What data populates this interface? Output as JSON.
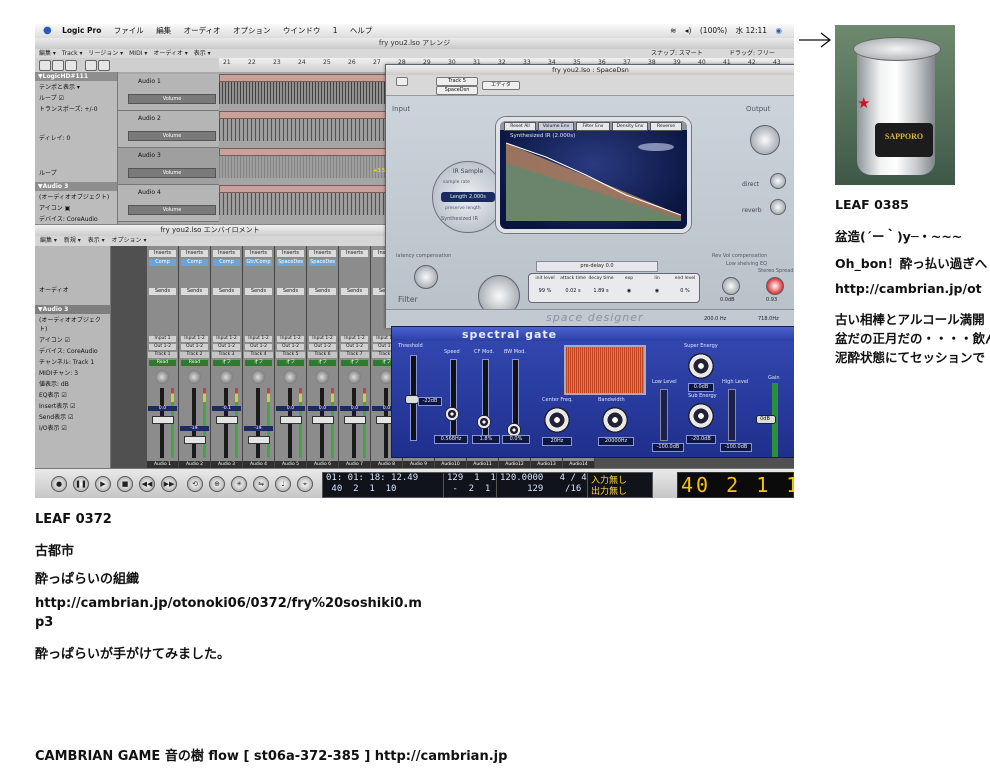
{
  "menubar": {
    "app": "Logic Pro",
    "items": [
      "ファイル",
      "編集",
      "オーディオ",
      "オプション",
      "ウインドウ",
      "1",
      "ヘルプ"
    ],
    "status": [
      "(100%)",
      "水 12:11"
    ]
  },
  "arrange": {
    "title": "fry you2.lso アレンジ",
    "toolbar": [
      "編集 ▾",
      "Track ▾",
      "リージョン ▾",
      "MIDI ▾",
      "オーディオ ▾",
      "表示 ▾"
    ],
    "toolbar_right": [
      "スナップ: スマート",
      "ドラッグ: フリー"
    ],
    "ruler": [
      "21",
      "22",
      "23",
      "24",
      "25",
      "26",
      "27",
      "28",
      "29",
      "30",
      "31",
      "32",
      "33",
      "34",
      "35",
      "36",
      "37",
      "38",
      "39",
      "40",
      "41",
      "42",
      "43"
    ],
    "inspector": {
      "header": "▼LogicHD#111",
      "rows": [
        "テンポと表示 ▾",
        "ループ ☑",
        "トランスポーズ: +/-0",
        "ディレイ: 0",
        "ループ",
        "▼Audio 3",
        "(オーディオオブジェクト)",
        "アイコン ▣",
        "デバイス: CoreAudio"
      ]
    },
    "tracks": [
      {
        "num": "1",
        "name": "Audio 1",
        "region": "LogicHD#109",
        "vol": "Volume"
      },
      {
        "num": "2",
        "name": "Audio 2",
        "region": "LogicHD#110",
        "vol": "Volume"
      },
      {
        "num": "3",
        "name": "Audio 3",
        "region": "LogicHD#111",
        "vol": "Volume"
      },
      {
        "num": "4",
        "name": "Audio 4",
        "region": "LogicHD#112",
        "vol": "Volume"
      }
    ],
    "region_gain": "+3.5 dB"
  },
  "environment": {
    "title": "fry you2.lso エンバイロメント",
    "tools": [
      "編集 ▾",
      "新規 ▾",
      "表示 ▾",
      "オプション ▾"
    ],
    "layer": "オーディオ",
    "left_header": "▼Audio 3",
    "left_rows": [
      "(オーディオオブジェクト)",
      "アイコン ☑",
      "デバイス: CoreAudio",
      "チャンネル: Track 1",
      "MIDIチャン: 3",
      "値表示: dB",
      "EQ表示 ☑",
      "Insert表示 ☑",
      "Send表示 ☑",
      "I/O表示 ☑"
    ],
    "strips": [
      {
        "ins": "Inserts",
        "plugin": "Comp",
        "io1": "Input 1",
        "io2": "Out 1-2",
        "track": "Track 1",
        "mode": "Read",
        "level": "0.0",
        "bottom": "Audio 1"
      },
      {
        "ins": "Inserts",
        "plugin": "Comp",
        "io1": "Input 1-2",
        "io2": "Out 1-2",
        "track": "Track 2",
        "mode": "Read",
        "level": "-19.",
        "bottom": "Audio 2"
      },
      {
        "ins": "Inserts",
        "plugin": "Comp",
        "io1": "Input 1-2",
        "io2": "Out 1-2",
        "track": "Track 3",
        "mode": "オフ",
        "level": "-0.1",
        "bottom": "Audio 3"
      },
      {
        "ins": "Inserts",
        "plugin": "Gtr/Comp",
        "io1": "Input 1-2",
        "io2": "Out 1-2",
        "track": "Track 4",
        "mode": "オフ",
        "level": "-19.",
        "bottom": "Audio 4"
      },
      {
        "ins": "Inserts",
        "plugin": "SpaceDes",
        "io1": "Input 1-2",
        "io2": "Out 1-2",
        "track": "Track 5",
        "mode": "オフ",
        "level": "0.0",
        "bottom": "Audio 5"
      },
      {
        "ins": "Inserts",
        "plugin": "SpaceDes",
        "io1": "Input 1-2",
        "io2": "Out 1-2",
        "track": "Track 6",
        "mode": "オフ",
        "level": "0.0",
        "bottom": "Audio 6"
      },
      {
        "ins": "Inserts",
        "plugin": "",
        "io1": "Input 1-2",
        "io2": "Out 1-2",
        "track": "Track 7",
        "mode": "オフ",
        "level": "0.0",
        "bottom": "Audio 7"
      },
      {
        "ins": "Inserts",
        "plugin": "",
        "io1": "Input 1-2",
        "io2": "Out 1-2",
        "track": "Track 8",
        "mode": "オフ",
        "level": "0.0",
        "bottom": "Audio 8"
      },
      {
        "ins": "Inserts",
        "plugin": "",
        "io1": "Input 1-2",
        "io2": "Out 1-2",
        "track": "Track 9",
        "mode": "オフ",
        "level": "0.0",
        "bottom": "Audio 9"
      },
      {
        "ins": "",
        "plugin": "",
        "io1": "",
        "io2": "",
        "track": "",
        "mode": "",
        "level": "",
        "bottom": "Audio10"
      },
      {
        "ins": "",
        "plugin": "",
        "io1": "",
        "io2": "",
        "track": "",
        "mode": "",
        "level": "",
        "bottom": "Audio11"
      },
      {
        "ins": "",
        "plugin": "",
        "io1": "",
        "io2": "",
        "track": "",
        "mode": "",
        "level": "",
        "bottom": "Audio12"
      },
      {
        "ins": "",
        "plugin": "",
        "io1": "",
        "io2": "",
        "track": "",
        "mode": "",
        "level": "",
        "bottom": "Audio13"
      },
      {
        "ins": "",
        "plugin": "",
        "io1": "",
        "io2": "",
        "track": "",
        "mode": "",
        "level": "",
        "bottom": "Audio14"
      }
    ],
    "sends_label": "Sends"
  },
  "space_designer": {
    "title": "fry you2.lso : SpaceDsn",
    "header_buttons": [
      "Track 5",
      "SpaceDsn",
      "エディタ"
    ],
    "tabs": [
      "Reset All",
      "Volume Env",
      "Filter Env",
      "Density Env",
      "Reverse"
    ],
    "display_label": "Synthesized IR (2.000s)",
    "ir_label": "IR Sample",
    "sample_rate": "sample rate",
    "length": "Length 2.000s",
    "preserve": "preserve length",
    "synth_ir": "Synthesized IR",
    "input": "Input",
    "output": "Output",
    "direct": "direct",
    "reverb": "reverb",
    "filter": "Filter",
    "latency": "latency compensation",
    "rev_vol": "Rev Vol compensation",
    "predelay": "pre-delay",
    "predelay_val": "0.0",
    "params_labels": [
      "init level",
      "attack time",
      "decay time",
      "exp",
      "lin",
      "end level"
    ],
    "params_vals": [
      "99 %",
      "0.02 s",
      "1.89 s",
      "◉",
      "◉",
      "0 %"
    ],
    "low_shelving": "Low shelving EQ",
    "stereo_spread": "Stereo Spread",
    "eq_vals": [
      "0.0dB",
      "200.0 Hz",
      "0.93",
      "718.0Hz"
    ],
    "brand": "space designer",
    "footer_button": "SpaceDsn"
  },
  "spectral_gate": {
    "name": "spectral gate",
    "threshold": "Threshold",
    "threshold_val": "-22dB",
    "speed": "Speed",
    "speed_val": "0.568Hz",
    "cf_mod": "CF Mod.",
    "cf_mod_val": "1.8%",
    "bw_mod": "BW Mod.",
    "bw_mod_val": "0.0%",
    "center_freq": "Center Freq.",
    "center_val": "20Hz",
    "bandwidth": "Bandwidth",
    "bandwidth_val": "20000Hz",
    "low_level": "Low Level",
    "low_val": "-100.0dB",
    "super_energy": "Super Energy",
    "super_val": "0.0dB",
    "sub_energy": "Sub Energy",
    "sub_val": "-20.0dB",
    "high_level": "High Level",
    "high_val": "-100.0dB",
    "gain": "Gain",
    "gain_val": "0dB",
    "brand": "Emagic"
  },
  "transport": {
    "position_row1": "01: 01: 18: 12.49",
    "position_row2": " 40  2  1  10",
    "bars_row1": "129  1  1  1",
    "bars_row2": " -  2  1  1",
    "tempo_row1": "120.0000   4 / 4",
    "tempo_row2": "     129    /16",
    "inout_row1": "入力無し",
    "inout_row2": "出力無し",
    "big_counter": "40 2 1 10"
  },
  "leaf_left": {
    "title": "LEAF 0372",
    "place": "古都市",
    "subtitle": "酔っぱらいの組織",
    "url_line1": "http://cambrian.jp/otonoki06/0372/fry%20soshiki0.m",
    "url_line2": "p3",
    "comment": "酔っぱらいが手がけてみました。"
  },
  "leaf_right": {
    "title": "LEAF 0385",
    "line1": "盆造(´ー｀)y─・~~~",
    "line2": "Oh_bon！酔っ払い過ぎへ",
    "url": "http://cambrian.jp/ot",
    "line3": "古い相棒とアルコール満開",
    "line4": "盆だの正月だの・・・・飲んで",
    "line5": "泥酔状態にてセッションで",
    "can_text": "SAPPORO"
  },
  "footer": {
    "text": "CAMBRIAN GAME  音の樹  flow [ st06a-372-385 ]   http://cambrian.jp"
  },
  "colors": {
    "spectral_gate_bg": "#2a3a9e",
    "space_designer_display": "#13205a",
    "counter_yellow": "#f7c400"
  }
}
